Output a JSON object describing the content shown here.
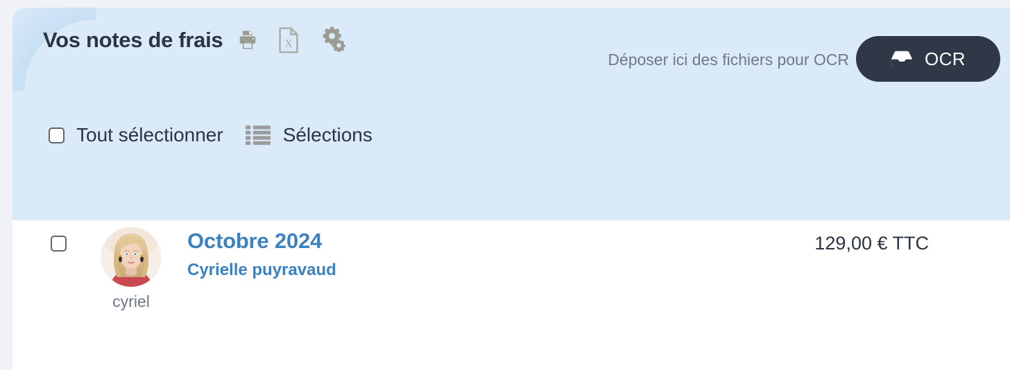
{
  "header": {
    "title": "Vos notes de frais",
    "icons": [
      {
        "name": "print-icon",
        "label": "Imprimer"
      },
      {
        "name": "excel-export-icon",
        "label": "X"
      },
      {
        "name": "settings-gears-icon",
        "label": "Paramètres"
      }
    ],
    "drop_text": "Déposer ici des fichiers pour OCR",
    "ocr_button": {
      "label": "OCR",
      "icon": "inbox-tray-icon",
      "bg_color": "#2e3847",
      "text_color": "#ffffff"
    },
    "bg_color": "#dbeaf9"
  },
  "toolbar": {
    "select_all_label": "Tout sélectionner",
    "select_all_checked": false,
    "selections_label": "Sélections",
    "selections_icon": "list-icon"
  },
  "list": {
    "rows": [
      {
        "checked": false,
        "avatar_name": "cyriel",
        "title": "Octobre 2024",
        "subtitle": "Cyrielle puyravaud",
        "amount": "129,00 € TTC",
        "link_color": "#3c81c1"
      }
    ]
  }
}
